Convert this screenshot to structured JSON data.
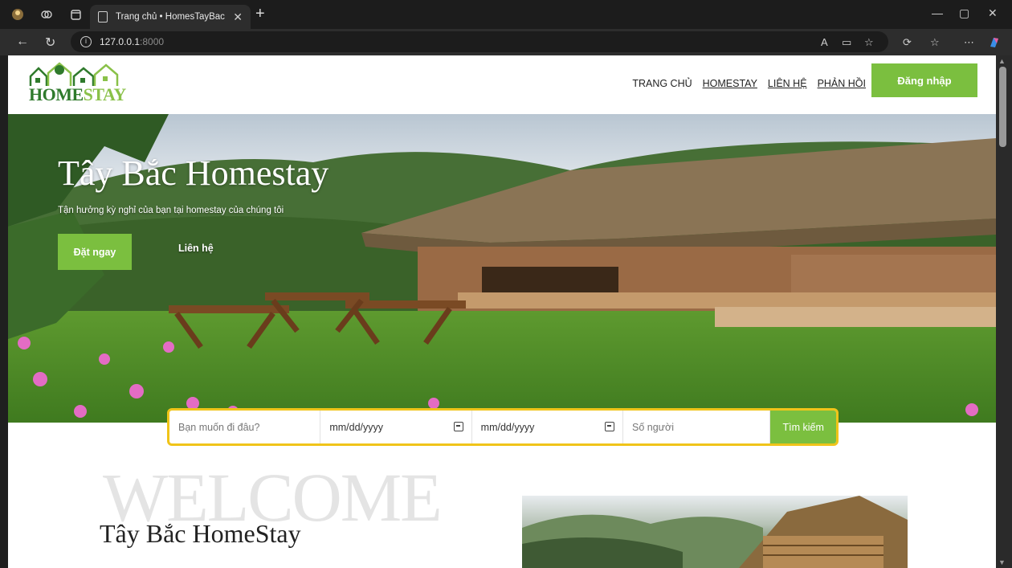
{
  "browser": {
    "tab_title": "Trang chủ • HomesTayBac",
    "url_host": "127.0.0.1",
    "url_port": ":8000"
  },
  "header": {
    "logo_text_main": "HOME",
    "logo_text_accent": "STAY",
    "nav": [
      {
        "label": "TRANG CHỦ"
      },
      {
        "label": "HOMESTAY"
      },
      {
        "label": "LIÊN HỆ"
      },
      {
        "label": "PHẢN HỒI"
      }
    ],
    "login_label": "Đăng nhập"
  },
  "hero": {
    "title": "Tây Bắc Homestay",
    "subtitle": "Tận hưởng kỳ nghỉ của bạn tại homestay của chúng tôi",
    "book_label": "Đặt ngay",
    "contact_label": "Liên hệ"
  },
  "search": {
    "destination_placeholder": "Bạn muốn đi đâu?",
    "checkin_placeholder": "mm/dd/yyyy",
    "checkout_placeholder": "mm/dd/yyyy",
    "guests_placeholder": "Số người",
    "submit_label": "Tìm kiếm"
  },
  "about": {
    "welcome": "WELCOME",
    "title": "Tây Bắc HomeStay"
  },
  "colors": {
    "accent_green": "#7bbf3f",
    "search_border": "#f0c419"
  }
}
